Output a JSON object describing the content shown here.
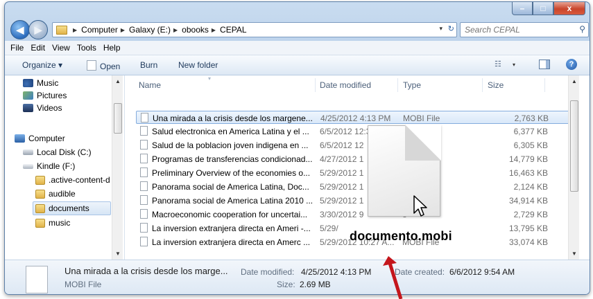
{
  "window": {
    "min_glyph": "–",
    "max_glyph": "□",
    "close_glyph": "x",
    "colors": {
      "frame": "#b9d1ec",
      "close": "#c9452b",
      "selection": "#d9e8f9"
    }
  },
  "nav": {
    "back_glyph": "◀",
    "forward_glyph": "▶"
  },
  "address": {
    "crumbs": [
      "Computer",
      "Galaxy (E:)",
      "obooks",
      "CEPAL"
    ],
    "dropdown_glyph": "▾",
    "refresh_glyph": "↻"
  },
  "search": {
    "placeholder": "Search CEPAL",
    "icon": "search-icon"
  },
  "menu": [
    "File",
    "Edit",
    "View",
    "Tools",
    "Help"
  ],
  "toolbar": {
    "organize": "Organize ▾",
    "open": "Open",
    "burn": "Burn",
    "new_folder": "New folder",
    "view_glyph": "☷",
    "view_drop": "▾",
    "help_glyph": "?"
  },
  "sidebar": {
    "items": [
      {
        "label": "Music",
        "icon": "music-icon"
      },
      {
        "label": "Pictures",
        "icon": "pictures-icon"
      },
      {
        "label": "Videos",
        "icon": "videos-icon"
      },
      {
        "label": "Computer",
        "icon": "computer-icon"
      },
      {
        "label": "Local Disk (C:)",
        "icon": "disk-icon"
      },
      {
        "label": "Kindle (F:)",
        "icon": "kindle-icon"
      },
      {
        "label": ".active-content-d",
        "icon": "folder-icon"
      },
      {
        "label": "audible",
        "icon": "folder-icon"
      },
      {
        "label": "documents",
        "icon": "folder-icon"
      },
      {
        "label": "music",
        "icon": "folder-icon"
      }
    ],
    "scroll_up": "▲",
    "scroll_down": "▼"
  },
  "files": {
    "headers": {
      "name": "Name",
      "date": "Date modified",
      "type": "Type",
      "size": "Size"
    },
    "rows": [
      {
        "name": "Una mirada a la crisis desde los margene...",
        "date": "4/25/2012 4:13 PM",
        "type": "MOBI File",
        "size": "2,763 KB"
      },
      {
        "name": "Salud electronica en America Latina y el ...",
        "date": "6/5/2012 12:30 PM",
        "type": "MOBI File",
        "size": "6,377 KB"
      },
      {
        "name": "Salud de la poblacion joven indigena en ...",
        "date": "6/5/2012 12",
        "type": "File",
        "size": "6,305 KB"
      },
      {
        "name": "Programas de transferencias condicionad...",
        "date": "4/27/2012 1",
        "type": "e",
        "size": "14,779 KB"
      },
      {
        "name": "Preliminary Overview of the economies o...",
        "date": "5/29/2012 1",
        "type": "e",
        "size": "16,463 KB"
      },
      {
        "name": "Panorama social de America Latina, Doc...",
        "date": "5/29/2012 1",
        "type": "e",
        "size": "2,124 KB"
      },
      {
        "name": "Panorama social de America Latina 2010 ...",
        "date": "5/29/2012 1",
        "type": "e",
        "size": "34,914 KB"
      },
      {
        "name": "Macroeconomic cooperation for uncertai...",
        "date": "3/30/2012 9",
        "type": "e",
        "size": "2,729 KB"
      },
      {
        "name": "La inversion extranjera directa en Ameri -...",
        "date": "5/29/",
        "type": "",
        "size": "13,795 KB"
      },
      {
        "name": "La inversion extranjera directa en Amerc ...",
        "date": "5/29/2012 10:27 A...",
        "type": "MOBI File",
        "size": "33,074 KB"
      }
    ],
    "scroll_up": "▲",
    "scroll_down": "▼"
  },
  "drag": {
    "filename": "documento.mobi"
  },
  "details": {
    "title": "Una mirada a la crisis desde los marge...",
    "type": "MOBI File",
    "modified_label": "Date modified:",
    "modified_value": "4/25/2012 4:13 PM",
    "size_label": "Size:",
    "size_value": "2.69 MB",
    "created_label": "Date created:",
    "created_value": "6/6/2012 9:54 AM"
  }
}
